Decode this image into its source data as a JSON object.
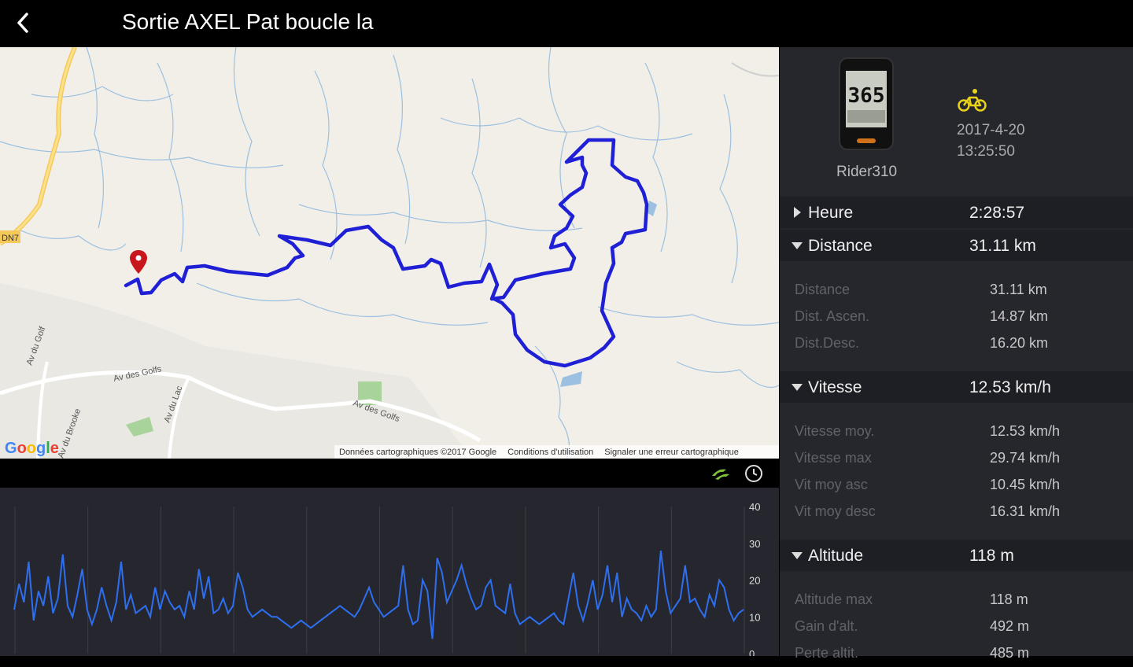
{
  "header": {
    "title": "Sortie AXEL Pat boucle la"
  },
  "map": {
    "labels": [
      "DN7",
      "Av du Golf",
      "Av des Golfs",
      "Av du Lac",
      "Av des Golfs",
      "Av du Brooke"
    ],
    "logo": "Google",
    "attribution": [
      "Données cartographiques ©2017 Google",
      "Conditions d'utilisation",
      "Signaler une erreur cartographique"
    ],
    "route_color": "#1f1fd6"
  },
  "chart": {
    "toolbar_icons": [
      "speed-icon",
      "clock-icon"
    ],
    "y_ticks": [
      "40",
      "30",
      "20",
      "10",
      "0"
    ]
  },
  "chart_data": {
    "type": "line",
    "title": "",
    "xlabel": "",
    "ylabel": "",
    "ylim": [
      0,
      40
    ],
    "series": [
      {
        "values": [
          12,
          19,
          14,
          25,
          9,
          17,
          13,
          21,
          11,
          15,
          27,
          13,
          10,
          16,
          23,
          12,
          8,
          12,
          18,
          13,
          9,
          14,
          25,
          12,
          16,
          11,
          12,
          13,
          10,
          18,
          12,
          17,
          14,
          12,
          13,
          10,
          17,
          12,
          23,
          15,
          21,
          11,
          12,
          15,
          11,
          13,
          22,
          18,
          12,
          10,
          11,
          12,
          11,
          10,
          10,
          9,
          8,
          7,
          8,
          9,
          8,
          7,
          8,
          9,
          10,
          11,
          12,
          13,
          12,
          11,
          10,
          12,
          15,
          18,
          14,
          12,
          10,
          11,
          12,
          13,
          24,
          12,
          8,
          9,
          20,
          17,
          4,
          26,
          22,
          14,
          17,
          20,
          24,
          19,
          15,
          12,
          13,
          18,
          20,
          13,
          12,
          11,
          19,
          11,
          8,
          9,
          10,
          9,
          8,
          9,
          10,
          11,
          9,
          8,
          15,
          22,
          13,
          9,
          14,
          20,
          12,
          16,
          24,
          14,
          22,
          10,
          15,
          12,
          11,
          9,
          13,
          10,
          12,
          28,
          17,
          11,
          13,
          15,
          24,
          14,
          15,
          12,
          10,
          16,
          13,
          20,
          18,
          12,
          9,
          11,
          12
        ]
      }
    ]
  },
  "device": {
    "name": "Rider310",
    "screen_value": "365",
    "date": "2017-4-20",
    "time": "13:25:50"
  },
  "stats": {
    "heure": {
      "label": "Heure",
      "value": "2:28:57"
    },
    "distance": {
      "label": "Distance",
      "value": "31.11 km",
      "rows": [
        {
          "k": "Distance",
          "v": "31.11 km"
        },
        {
          "k": "Dist. Ascen.",
          "v": "14.87 km"
        },
        {
          "k": "Dist.Desc.",
          "v": "16.20 km"
        }
      ]
    },
    "vitesse": {
      "label": "Vitesse",
      "value": "12.53 km/h",
      "rows": [
        {
          "k": "Vitesse moy.",
          "v": "12.53 km/h"
        },
        {
          "k": "Vitesse max",
          "v": "29.74 km/h"
        },
        {
          "k": "Vit moy asc",
          "v": "10.45 km/h"
        },
        {
          "k": "Vit moy desc",
          "v": "16.31 km/h"
        }
      ]
    },
    "altitude": {
      "label": "Altitude",
      "value": "118 m",
      "rows": [
        {
          "k": "Altitude max",
          "v": "118 m"
        },
        {
          "k": "Gain d'alt.",
          "v": "492 m"
        },
        {
          "k": "Perte altit.",
          "v": "485 m"
        }
      ]
    }
  }
}
